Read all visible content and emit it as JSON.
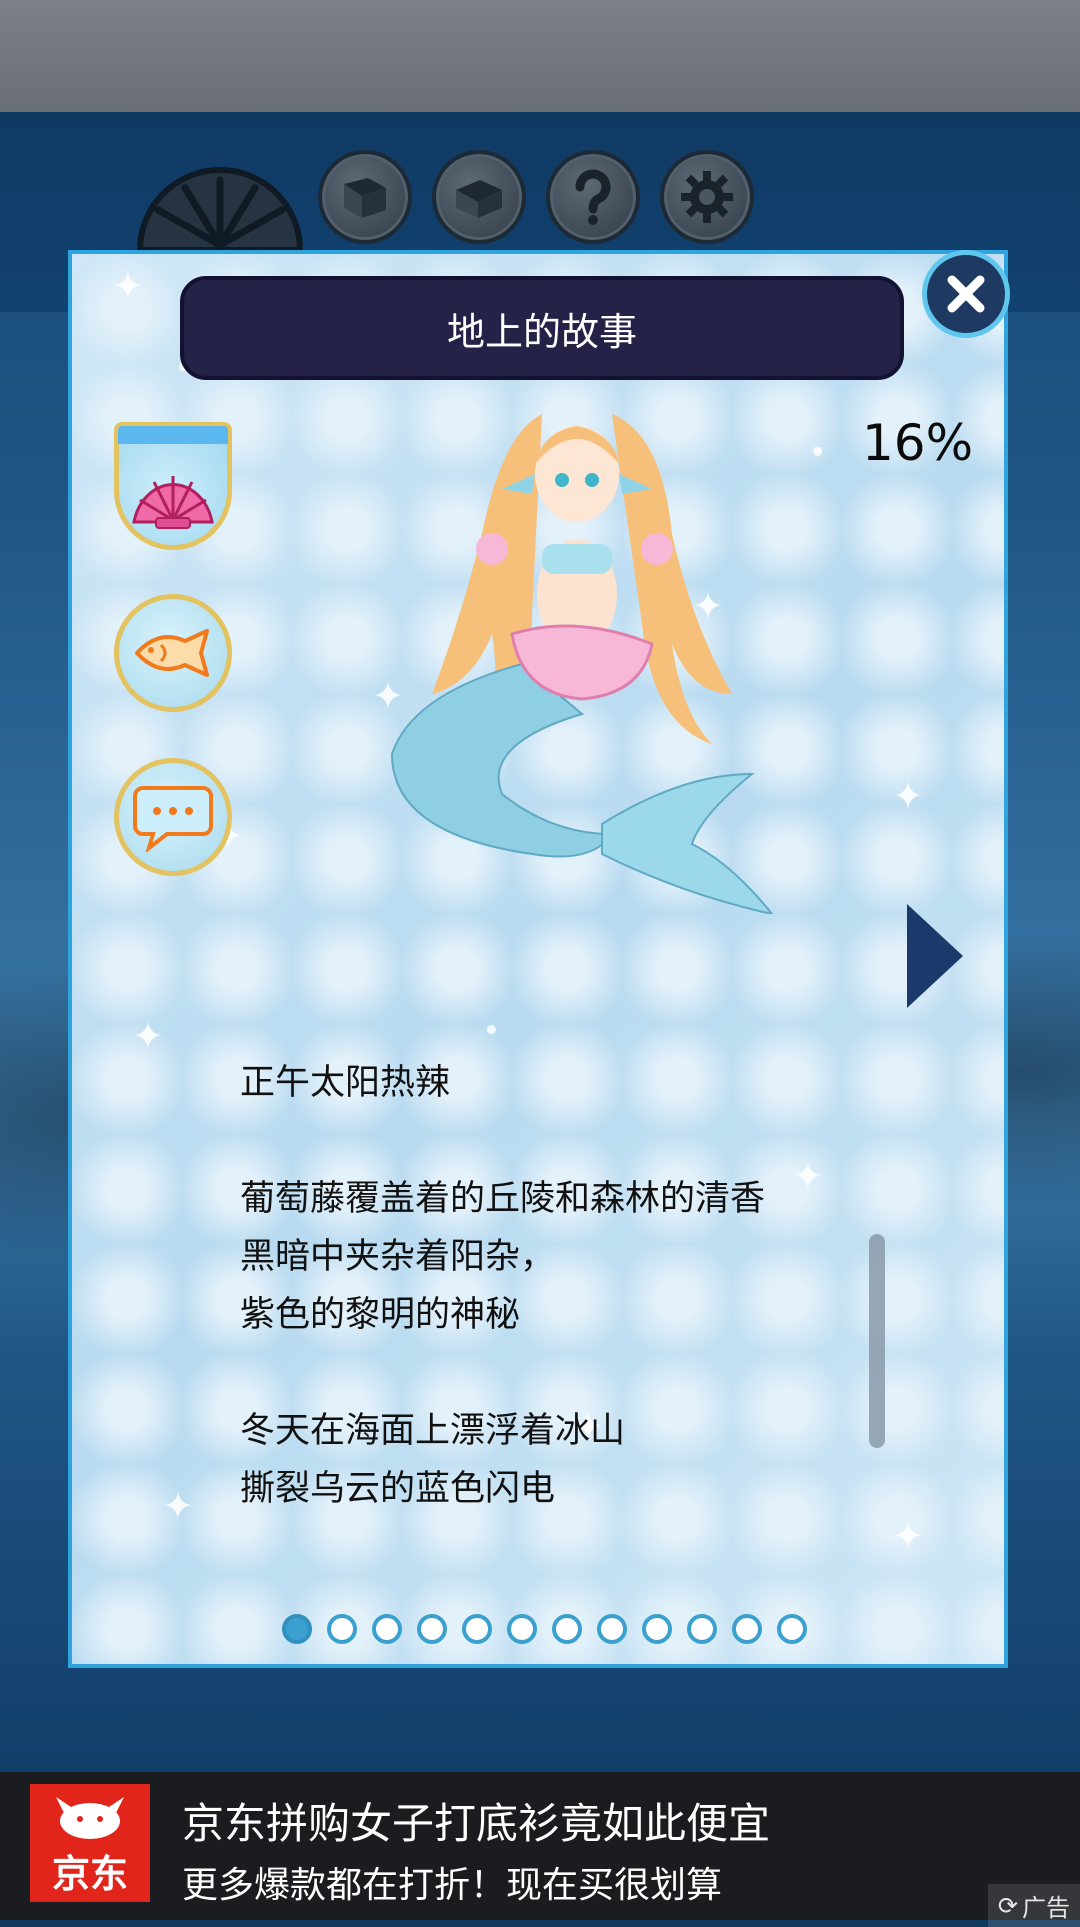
{
  "panel": {
    "title": "地上的故事",
    "percent": "16%",
    "story_lines": [
      "正午太阳热辣",
      "",
      "葡萄藤覆盖着的丘陵和森林的清香",
      "黑暗中夹杂着阳杂，",
      "紫色的黎明的神秘",
      "",
      "冬天在海面上漂浮着冰山",
      "撕裂乌云的蓝色闪电"
    ],
    "page_indicator": {
      "total": 12,
      "current": 1
    }
  },
  "top_icons": [
    "shell-icon",
    "book-icon",
    "open-book-icon",
    "question-icon",
    "gear-icon"
  ],
  "side_tabs": [
    "shell-icon",
    "fish-icon",
    "chat-bubble-icon"
  ],
  "ad": {
    "brand": "京东",
    "headline": "京东拼购女子打底衫竟如此便宜",
    "subline": "更多爆款都在打折！现在买很划算",
    "tag": "广告"
  },
  "colors": {
    "panel_border": "#2ea3dd",
    "title_bg": "#242347",
    "side_icon": "#f07a1c",
    "ad_red": "#e1251b"
  }
}
